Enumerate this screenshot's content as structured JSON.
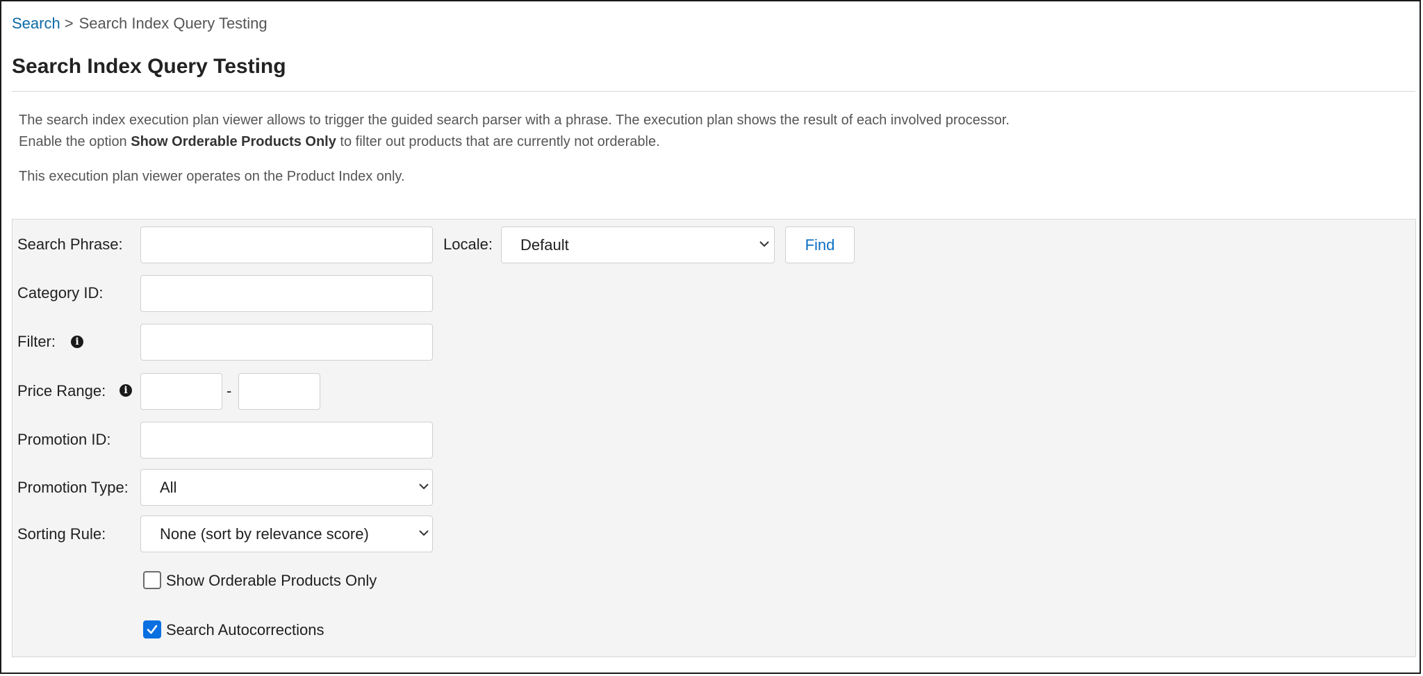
{
  "breadcrumb": {
    "parent": "Search",
    "separator": ">",
    "current": "Search Index Query Testing"
  },
  "page_title": "Search Index Query Testing",
  "description": {
    "line1": "The search index execution plan viewer allows to trigger the guided search parser with a phrase. The execution plan shows the result of each involved processor.",
    "line2_prefix": "Enable the option ",
    "line2_bold": "Show Orderable Products Only",
    "line2_suffix": " to filter out products that are currently not orderable.",
    "line3": "This execution plan viewer operates on the Product Index only."
  },
  "form": {
    "search_phrase_label": "Search Phrase:",
    "search_phrase_value": "",
    "locale_label": "Locale:",
    "locale_value": "Default",
    "find_label": "Find",
    "category_id_label": "Category ID:",
    "category_id_value": "",
    "filter_label": "Filter:",
    "filter_value": "",
    "price_range_label": "Price Range:",
    "price_from_value": "",
    "price_to_value": "",
    "price_range_separator": "-",
    "promotion_id_label": "Promotion ID:",
    "promotion_id_value": "",
    "promotion_type_label": "Promotion Type:",
    "promotion_type_value": "All",
    "sorting_rule_label": "Sorting Rule:",
    "sorting_rule_value": "None (sort by relevance score)",
    "orderable_only_label": "Show Orderable Products Only",
    "orderable_only_checked": false,
    "autocorrections_label": "Search Autocorrections",
    "autocorrections_checked": true
  },
  "icons": {
    "info": "info-icon",
    "dropdown": "chevron-down-icon",
    "check": "checkmark-icon"
  },
  "colors": {
    "link": "#0b6aa7",
    "button_text": "#0b6ec5",
    "checkbox_checked": "#0a6fe0",
    "panel_bg": "#f4f4f4"
  }
}
